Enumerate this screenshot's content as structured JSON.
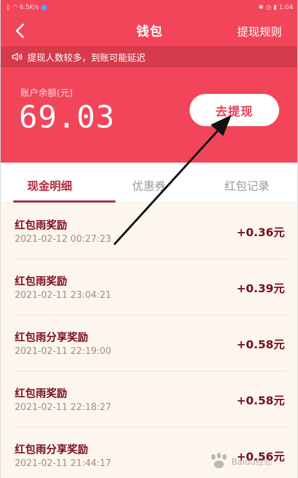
{
  "status_bar": {
    "left": "6.5K/s",
    "right": "1:04"
  },
  "header": {
    "title": "钱包",
    "rules_label": "提现规则"
  },
  "notice": {
    "text": "提现人数较多，到账可能延迟"
  },
  "balance": {
    "label": "账户余额(元)",
    "value": "69.03",
    "withdraw_label": "去提现"
  },
  "tabs": [
    {
      "label": "现金明细",
      "active": true
    },
    {
      "label": "优惠券",
      "active": false
    },
    {
      "label": "红包记录",
      "active": false
    }
  ],
  "records": [
    {
      "name": "红包雨奖励",
      "time": "2021-02-12 00:27:23",
      "amount": "+0.36元"
    },
    {
      "name": "红包雨奖励",
      "time": "2021-02-11 23:04:21",
      "amount": "+0.39元"
    },
    {
      "name": "红包雨分享奖励",
      "time": "2021-02-11 22:19:00",
      "amount": "+0.58元"
    },
    {
      "name": "红包雨奖励",
      "time": "2021-02-11 22:18:27",
      "amount": "+0.58元"
    },
    {
      "name": "红包雨分享奖励",
      "time": "2021-02-11 21:44:17",
      "amount": "+0.56元"
    }
  ],
  "watermark": {
    "text": "Baidu经验"
  },
  "colors": {
    "brand": "#f2455a",
    "notice": "#d63a4d",
    "accent": "#b6283c",
    "list_bg": "#fdf6ee"
  }
}
